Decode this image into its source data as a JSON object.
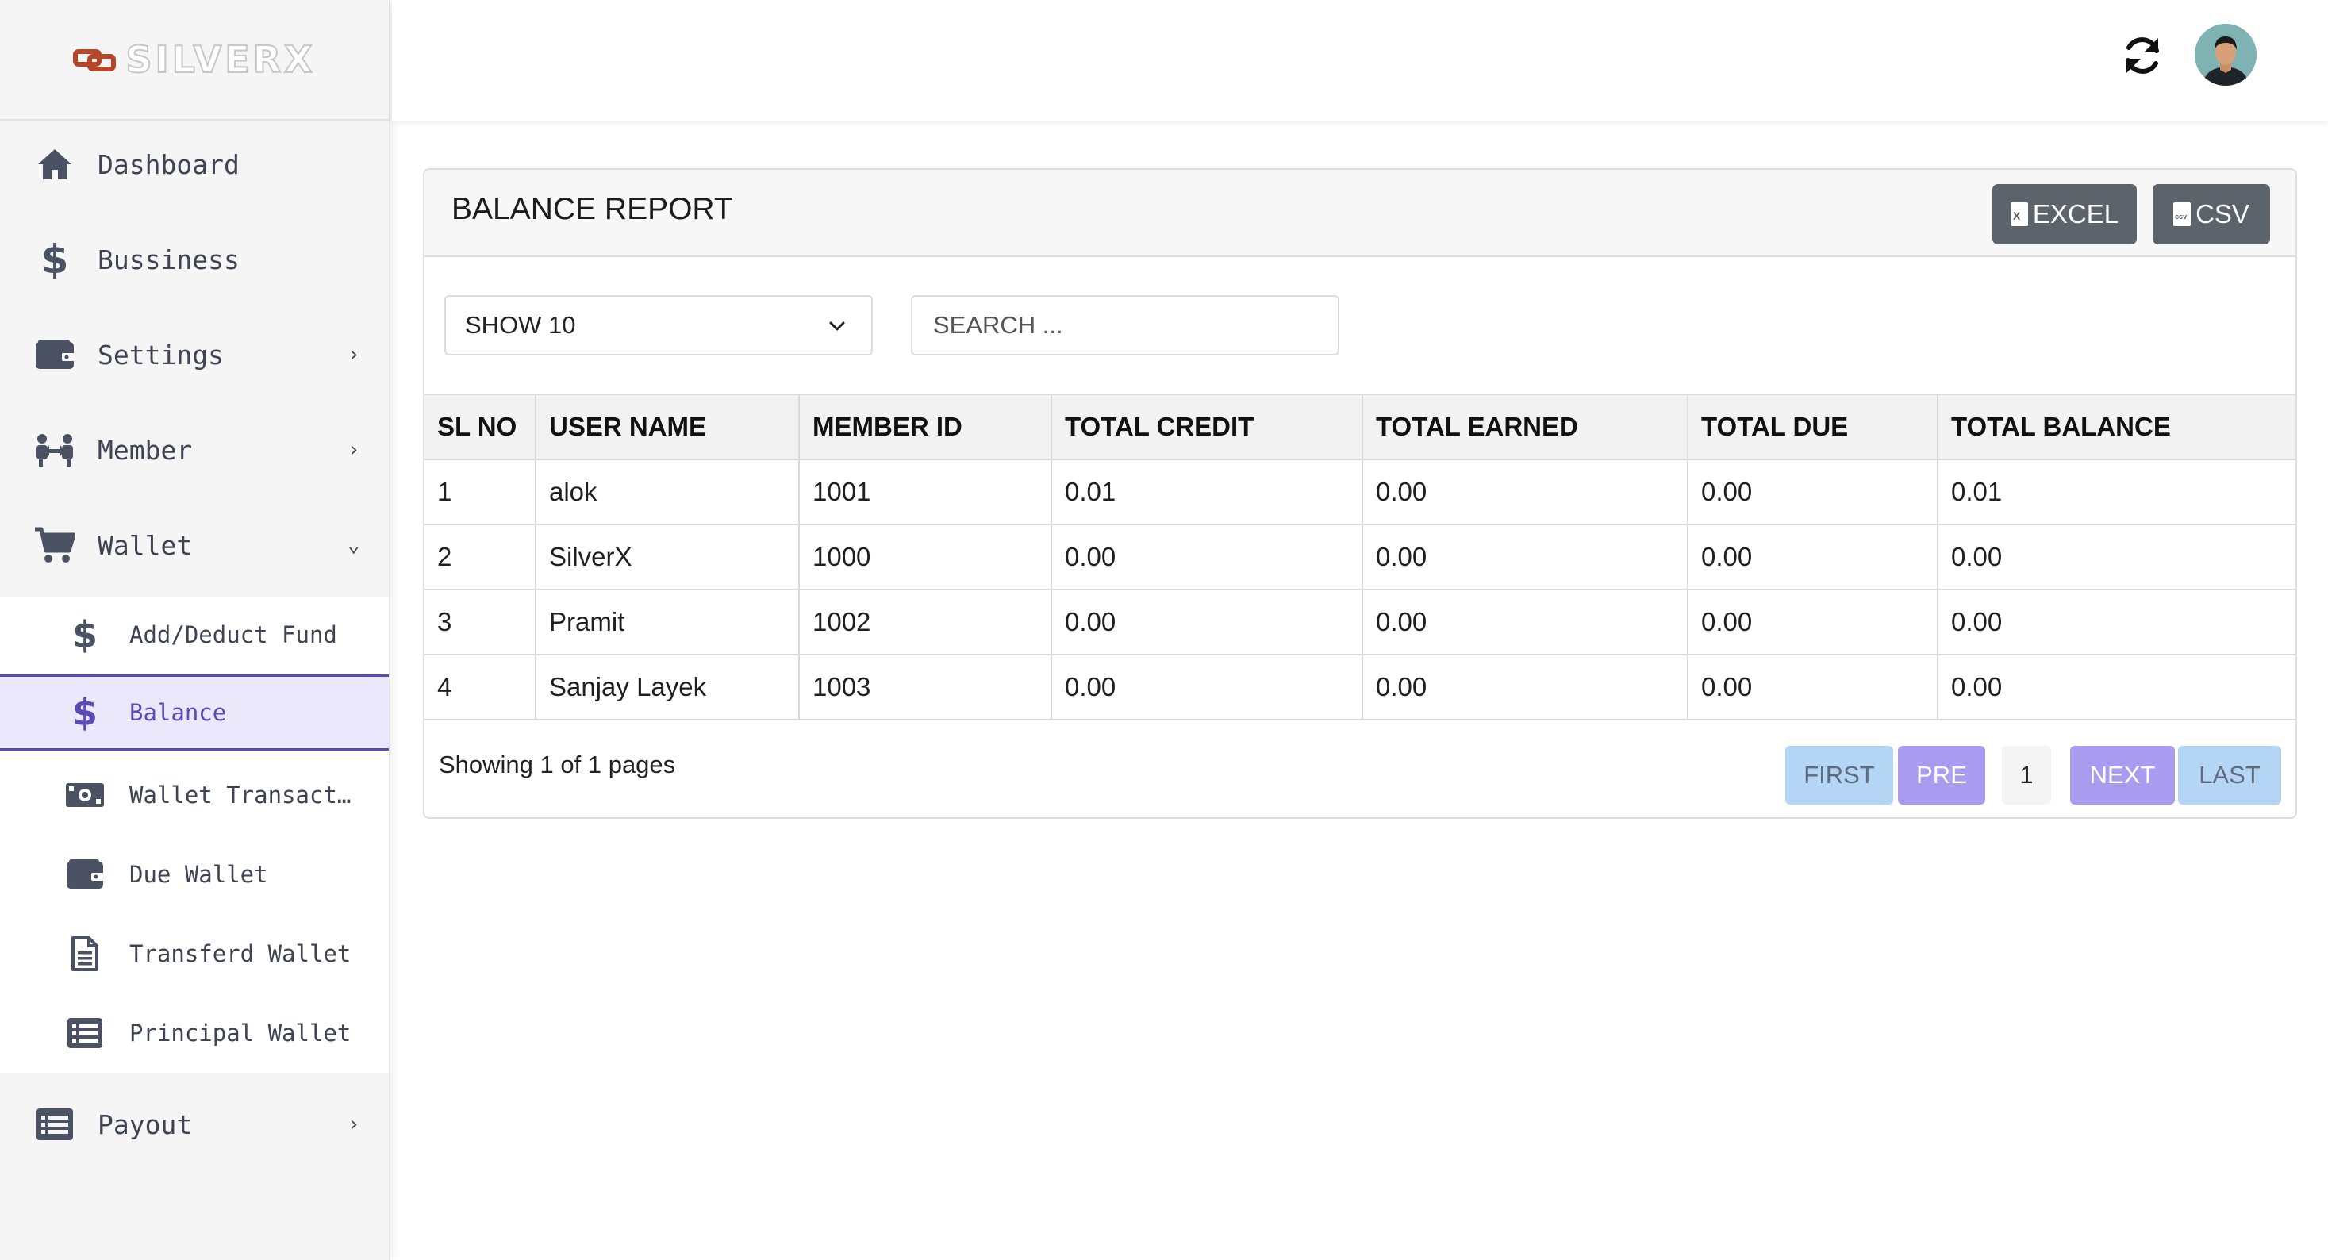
{
  "brand": {
    "name": "SILVERX",
    "accent": "#5b4bb7",
    "logo_color": "#b5462a"
  },
  "sidebar": {
    "items": [
      {
        "label": "Dashboard",
        "icon": "home-icon"
      },
      {
        "label": "Bussiness",
        "icon": "dollar-icon"
      },
      {
        "label": "Settings",
        "icon": "wallet-icon",
        "arrow": "›"
      },
      {
        "label": "Member",
        "icon": "users-icon",
        "arrow": "›"
      },
      {
        "label": "Wallet",
        "icon": "cart-icon",
        "arrow": "⌄"
      },
      {
        "label": "Payout",
        "icon": "list-icon",
        "arrow": "›"
      }
    ],
    "wallet_submenu": [
      {
        "label": "Add/Deduct Fund",
        "icon": "dollar-icon"
      },
      {
        "label": "Balance",
        "icon": "dollar-icon",
        "active": true
      },
      {
        "label": "Wallet Transactions",
        "icon": "money-bill-icon"
      },
      {
        "label": "Due Wallet",
        "icon": "wallet-icon"
      },
      {
        "label": "Transferd Wallet",
        "icon": "file-text-icon"
      },
      {
        "label": "Principal Wallet",
        "icon": "list-icon"
      }
    ]
  },
  "header": {
    "refresh_icon": "refresh-icon",
    "avatar_icon": "user-avatar"
  },
  "report": {
    "title": "BALANCE REPORT",
    "excel_label": "EXCEL",
    "csv_label": "CSV",
    "show_label": "SHOW 10",
    "search_placeholder": "SEARCH ...",
    "columns": [
      "SL NO",
      "USER NAME",
      "MEMBER ID",
      "TOTAL CREDIT",
      "TOTAL EARNED",
      "TOTAL DUE",
      "TOTAL BALANCE"
    ],
    "rows": [
      [
        "1",
        "alok",
        "1001",
        "0.01",
        "0.00",
        "0.00",
        "0.01"
      ],
      [
        "2",
        "SilverX",
        "1000",
        "0.00",
        "0.00",
        "0.00",
        "0.00"
      ],
      [
        "3",
        "Pramit",
        "1002",
        "0.00",
        "0.00",
        "0.00",
        "0.00"
      ],
      [
        "4",
        "Sanjay Layek",
        "1003",
        "0.00",
        "0.00",
        "0.00",
        "0.00"
      ]
    ],
    "showing_text": "Showing 1 of 1 pages",
    "pagination": {
      "first": "FIRST",
      "pre": "PRE",
      "current": "1",
      "next": "NEXT",
      "last": "LAST"
    }
  }
}
